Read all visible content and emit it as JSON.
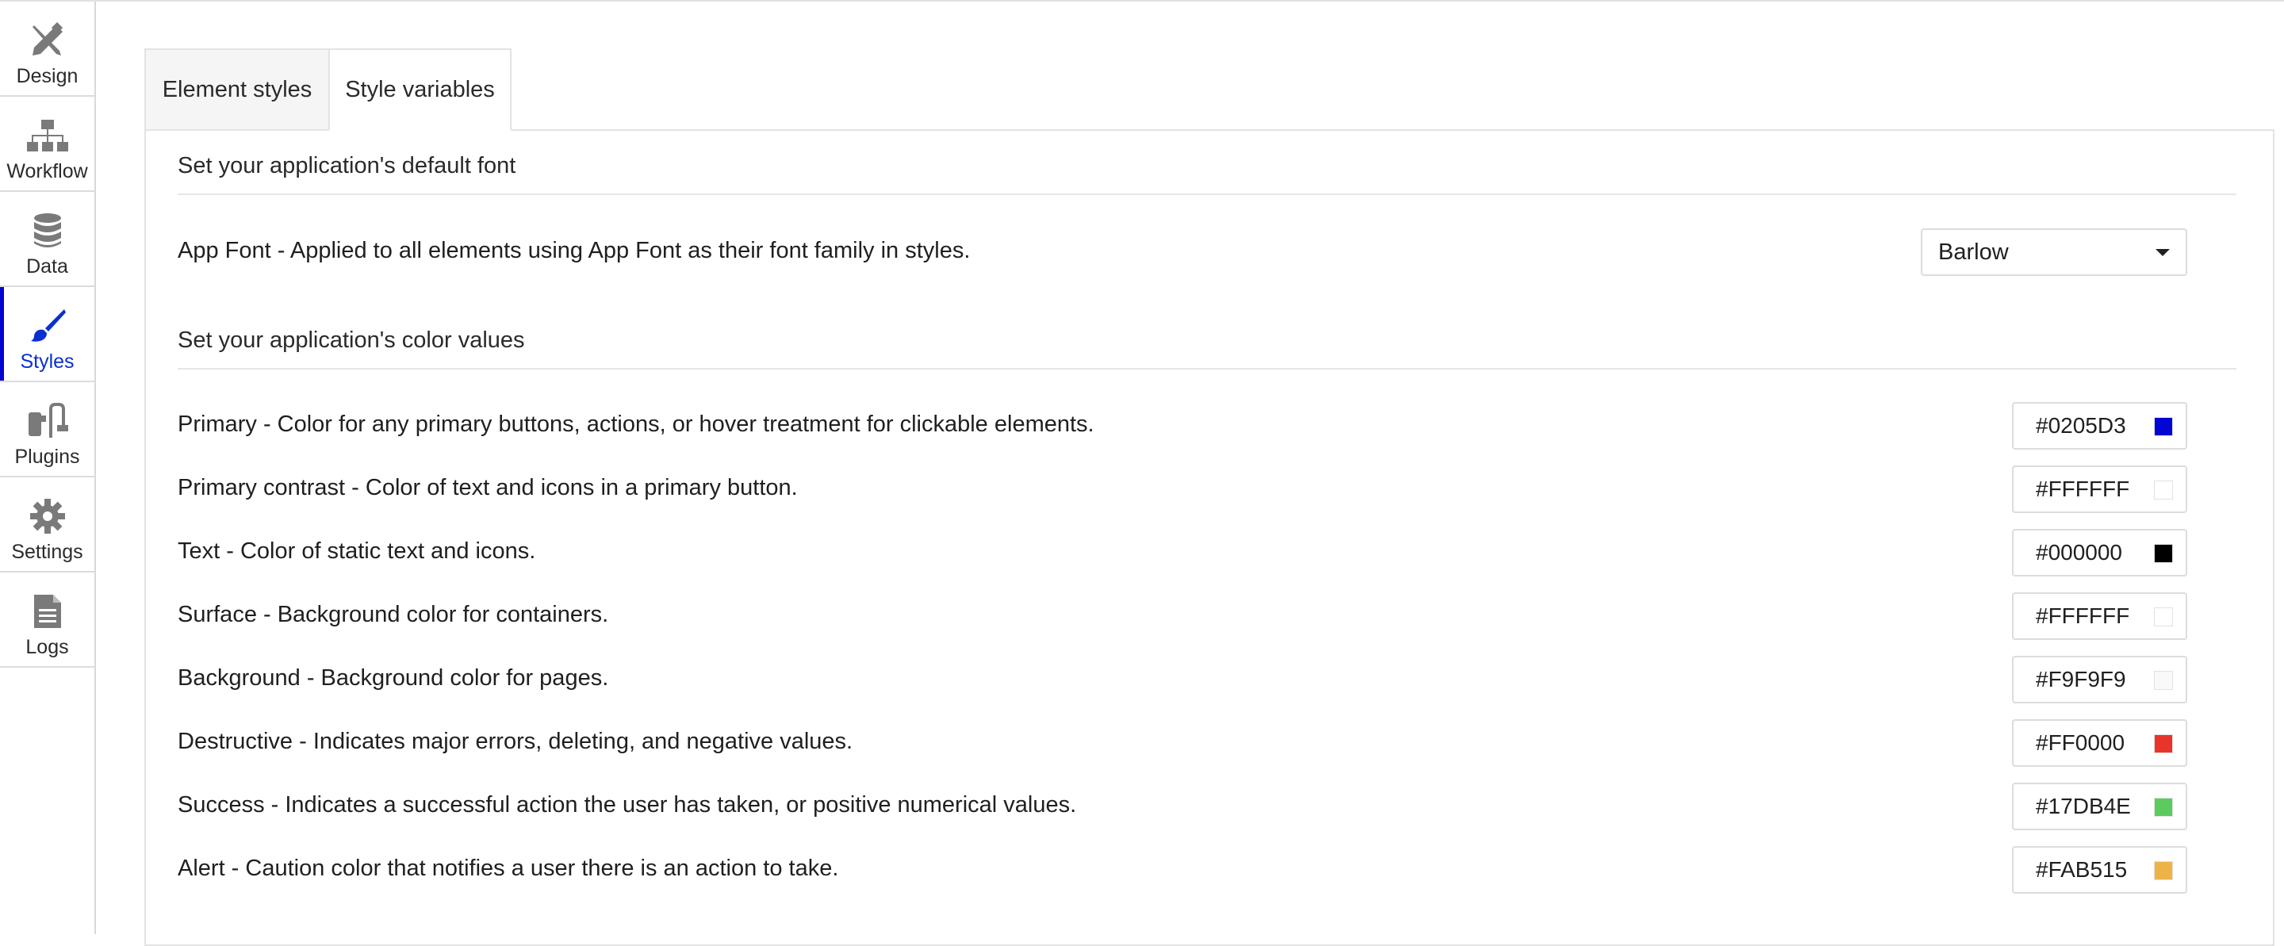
{
  "sidebar": {
    "items": [
      {
        "label": "Design",
        "icon": "design-icon"
      },
      {
        "label": "Workflow",
        "icon": "workflow-icon"
      },
      {
        "label": "Data",
        "icon": "database-icon"
      },
      {
        "label": "Styles",
        "icon": "paintbrush-icon",
        "active": true
      },
      {
        "label": "Plugins",
        "icon": "plug-icon"
      },
      {
        "label": "Settings",
        "icon": "gear-icon"
      },
      {
        "label": "Logs",
        "icon": "document-icon"
      }
    ]
  },
  "tabs": [
    {
      "label": "Element styles"
    },
    {
      "label": "Style variables",
      "active": true
    }
  ],
  "font_section": {
    "title": "Set your application's default font",
    "row_label": "App Font - Applied to all elements using App Font as their font family in styles.",
    "selected_font": "Barlow"
  },
  "color_section": {
    "title": "Set your application's color values",
    "rows": [
      {
        "label": "Primary - Color for any primary buttons, actions, or hover treatment for clickable elements.",
        "value": "#0205D3",
        "swatch": "#0205D3"
      },
      {
        "label": "Primary contrast - Color of text and icons in a primary button.",
        "value": "#FFFFFF",
        "swatch": "#FFFFFF"
      },
      {
        "label": "Text - Color of static text and icons.",
        "value": "#000000",
        "swatch": "#000000"
      },
      {
        "label": "Surface - Background color for containers.",
        "value": "#FFFFFF",
        "swatch": "#FFFFFF"
      },
      {
        "label": "Background - Background color for pages.",
        "value": "#F9F9F9",
        "swatch": "#F9F9F9"
      },
      {
        "label": "Destructive - Indicates major errors, deleting, and negative values.",
        "value": "#FF0000",
        "swatch": "#E8352B"
      },
      {
        "label": "Success - Indicates a successful action the user has taken, or positive numerical values.",
        "value": "#17DB4E",
        "swatch": "#5CCB5F"
      },
      {
        "label": "Alert - Caution color that notifies a user there is an action to take.",
        "value": "#FAB515",
        "swatch": "#EEB347"
      }
    ]
  },
  "colors": {
    "accent": "#0205D3",
    "border": "#DCDCDC",
    "icon_gray": "#7A7A7A"
  }
}
